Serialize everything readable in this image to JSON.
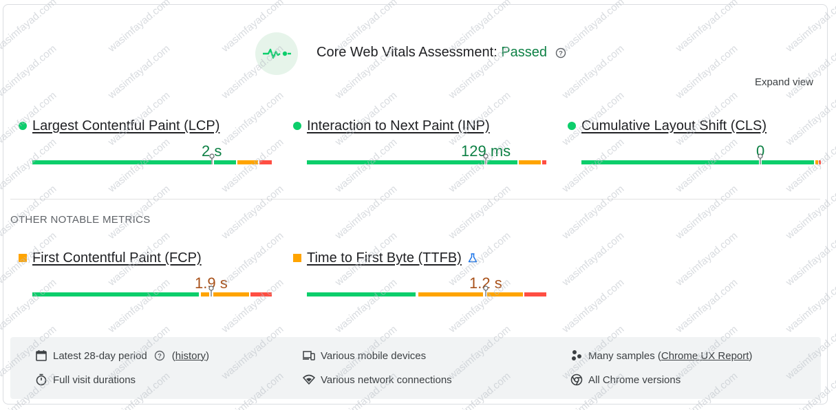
{
  "assessment": {
    "title": "Core Web Vitals Assessment:",
    "status": "Passed",
    "status_color": "#0d8044",
    "icon": "pulse-icon",
    "help_icon": "help-icon"
  },
  "expand_label": "Expand view",
  "core_metrics": [
    {
      "name": "Largest Contentful Paint (LCP)",
      "value": "2 s",
      "status": "good",
      "status_color": "#0cce6b",
      "value_color": "#0d8044"
    },
    {
      "name": "Interaction to Next Paint (INP)",
      "value": "129 ms",
      "status": "good",
      "status_color": "#0cce6b",
      "value_color": "#0d8044"
    },
    {
      "name": "Cumulative Layout Shift (CLS)",
      "value": "0",
      "status": "good",
      "status_color": "#0cce6b",
      "value_color": "#0d8044"
    }
  ],
  "other_label": "OTHER NOTABLE METRICS",
  "other_metrics": [
    {
      "name": "First Contentful Paint (FCP)",
      "value": "1.9 s",
      "status": "needs-improvement",
      "status_color": "#ffa400",
      "value_color": "#a8511a"
    },
    {
      "name": "Time to First Byte (TTFB)",
      "value": "1.2 s",
      "status": "needs-improvement",
      "status_color": "#ffa400",
      "value_color": "#a8511a",
      "extra_icon": "experimental-flask-icon"
    }
  ],
  "bar_colors": {
    "good": "#0cce6b",
    "ni": "#ffa400",
    "poor": "#ff4e42"
  },
  "footer": {
    "period": "Latest 28-day period",
    "history_open": "(",
    "history_link": "history",
    "history_close": ")",
    "durations": "Full visit durations",
    "devices": "Various mobile devices",
    "network": "Various network connections",
    "samples_prefix": "Many samples (",
    "samples_link": "Chrome UX Report",
    "samples_suffix": ")",
    "versions": "All Chrome versions"
  },
  "watermark_text": "wasimfayad.com"
}
